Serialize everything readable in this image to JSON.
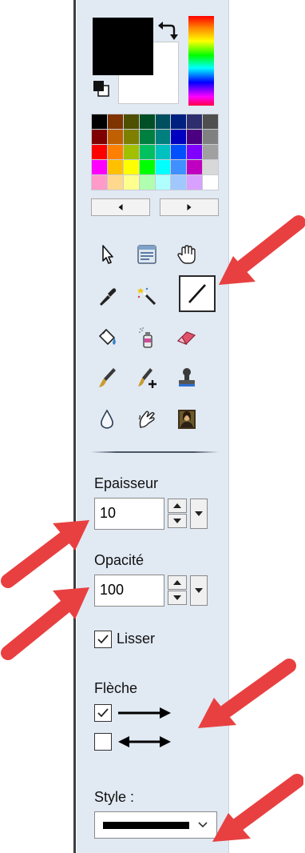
{
  "colors": {
    "primary": "#000000",
    "secondary": "#ffffff",
    "panel_bg": "#e1e9f3",
    "callout_arrow": "#e84040"
  },
  "palette": [
    "#000000",
    "#7f3300",
    "#4f4f00",
    "#004f26",
    "#004f5f",
    "#00207f",
    "#2e2e6e",
    "#4f4f4f",
    "#7f0000",
    "#c06000",
    "#7f7f00",
    "#008040",
    "#007f7f",
    "#0000c0",
    "#4b0082",
    "#808080",
    "#ff0000",
    "#ff8000",
    "#a0c000",
    "#00c060",
    "#00c0c0",
    "#0050ff",
    "#8000ff",
    "#a0a0a0",
    "#ff00ff",
    "#ffc000",
    "#ffff00",
    "#00ff00",
    "#00ffff",
    "#4090ff",
    "#c000c0",
    "#d8d8d8",
    "#ff9bc8",
    "#ffd890",
    "#ffff90",
    "#b0ffb0",
    "#b0ffff",
    "#a0c8ff",
    "#d8a0ff",
    "#ffffff"
  ],
  "icons": {
    "swap": "swap-colors-icon",
    "reset": "reset-colors-icon"
  },
  "tools": [
    {
      "name": "select-tool-button",
      "icon": "pointer-icon",
      "selected": false
    },
    {
      "name": "move-selection-tool-button",
      "icon": "window-select-icon",
      "selected": false
    },
    {
      "name": "pan-tool-button",
      "icon": "hand-icon",
      "selected": false
    },
    {
      "name": "color-picker-tool-button",
      "icon": "eyedropper-icon",
      "selected": false
    },
    {
      "name": "magic-wand-tool-button",
      "icon": "magic-wand-icon",
      "selected": false
    },
    {
      "name": "line-tool-button",
      "icon": "line-icon",
      "selected": true
    },
    {
      "name": "fill-tool-button",
      "icon": "paint-bucket-icon",
      "selected": false
    },
    {
      "name": "spray-tool-button",
      "icon": "spray-can-icon",
      "selected": false
    },
    {
      "name": "eraser-tool-button",
      "icon": "eraser-icon",
      "selected": false
    },
    {
      "name": "brush-tool-button",
      "icon": "brush-icon",
      "selected": false
    },
    {
      "name": "brush-plus-tool-button",
      "icon": "brush-plus-icon",
      "selected": false
    },
    {
      "name": "stamp-tool-button",
      "icon": "stamp-icon",
      "selected": false
    },
    {
      "name": "blur-tool-button",
      "icon": "drop-icon",
      "selected": false
    },
    {
      "name": "smudge-tool-button",
      "icon": "smudge-hand-icon",
      "selected": false
    },
    {
      "name": "image-tool-button",
      "icon": "mona-lisa-icon",
      "selected": false
    }
  ],
  "thickness": {
    "label": "Epaisseur",
    "value": "10"
  },
  "opacity": {
    "label": "Opacité",
    "value": "100"
  },
  "smooth": {
    "label": "Lisser",
    "checked": true
  },
  "arrow": {
    "label": "Flèche",
    "options": [
      {
        "name": "single-arrow",
        "checked": true
      },
      {
        "name": "double-arrow",
        "checked": false
      }
    ]
  },
  "style": {
    "label": "Style :"
  }
}
